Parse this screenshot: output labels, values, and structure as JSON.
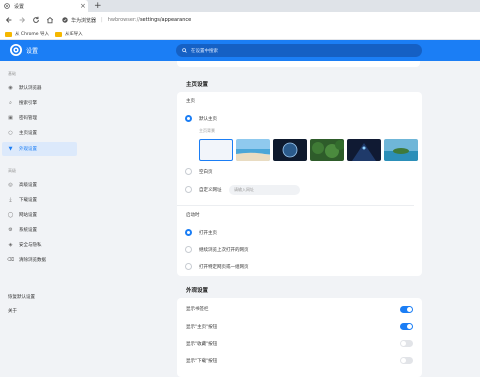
{
  "tab": {
    "title": "设置",
    "close": "×",
    "new_tab": "+"
  },
  "address": {
    "brand": "华为浏览器",
    "separator": "|",
    "host": "hwbrowser://",
    "path": "settings/appearance"
  },
  "bookmarks": [
    {
      "label": "从 Chrome 导入"
    },
    {
      "label": "从IE导入"
    }
  ],
  "header": {
    "title": "设置",
    "search_placeholder": "在设置中搜索"
  },
  "sidebar": {
    "group1": "基础",
    "items1": [
      {
        "label": "默认浏览器",
        "icon": "browser-icon"
      },
      {
        "label": "搜索引擎",
        "icon": "search-engine-icon"
      },
      {
        "label": "密码管理",
        "icon": "password-icon"
      },
      {
        "label": "主页设置",
        "icon": "home-icon"
      },
      {
        "label": "外观设置",
        "icon": "appearance-icon"
      }
    ],
    "group2": "高级",
    "items2": [
      {
        "label": "高级设置",
        "icon": "advanced-icon"
      },
      {
        "label": "下载设置",
        "icon": "download-icon"
      },
      {
        "label": "网站设置",
        "icon": "site-icon"
      },
      {
        "label": "系统设置",
        "icon": "system-icon"
      },
      {
        "label": "安全与隐私",
        "icon": "security-icon"
      },
      {
        "label": "清除浏览数据",
        "icon": "clear-data-icon"
      }
    ],
    "reset": "恢复默认设置",
    "about": "关于"
  },
  "home": {
    "title": "主页设置",
    "homepage_label": "主页",
    "option_default": "默认主页",
    "theme_label": "主页背景",
    "option_blank": "空白页",
    "option_custom": "自定义网址",
    "url_placeholder": "请输入网址",
    "startup_label": "启动时",
    "startup_options": [
      "打开主页",
      "继续浏览上次打开的网页",
      "打开特定网页或一组网页"
    ]
  },
  "appearance": {
    "title": "外观设置",
    "rows": [
      {
        "label": "显示书签栏",
        "on": true
      },
      {
        "label": "显示\"主页\"按钮",
        "on": true
      },
      {
        "label": "显示\"收藏\"按钮",
        "on": false
      },
      {
        "label": "显示\"下载\"按钮",
        "on": false
      }
    ]
  },
  "colors": {
    "accent": "#1b7ef5",
    "header": "#1b7ef5"
  }
}
